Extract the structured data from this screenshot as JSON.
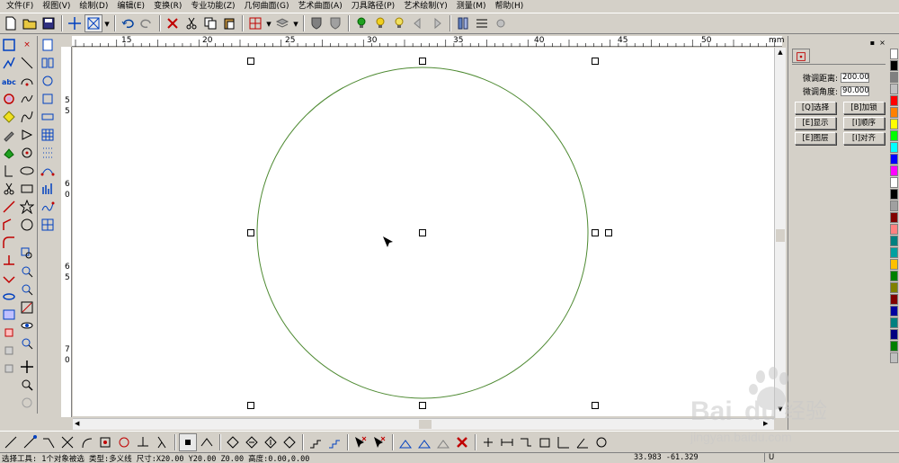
{
  "menu": [
    "文件(F)",
    "视图(V)",
    "绘制(D)",
    "编辑(E)",
    "变换(R)",
    "专业功能(Z)",
    "几何曲面(G)",
    "艺术曲面(A)",
    "刀具路径(P)",
    "艺术绘制(Y)",
    "测量(M)",
    "帮助(H)"
  ],
  "ruler": {
    "top_labels": [
      "15",
      "20",
      "25",
      "30",
      "35",
      "40",
      "45",
      "50"
    ],
    "unit": "mm",
    "left_labels": [
      "5",
      "5",
      "6",
      "0",
      "6",
      "5",
      "7",
      "0"
    ]
  },
  "panel": {
    "distance_label": "微调距离:",
    "distance_value": "200.00",
    "angle_label": "微调角度:",
    "angle_value": "90.000",
    "buttons": [
      "[Q]选择",
      "[B]加锁",
      "[E]显示",
      "[I]顺序",
      "[E]图层",
      "[I]对齐"
    ]
  },
  "status": {
    "text": "选择工具: 1个对象被选 类型:多义线 尺寸:X20.00 Y20.00 Z0.00 高度:0.00,0.00",
    "coords": "33.983  -61.329",
    "unit_indicator": "U"
  },
  "watermark": {
    "brand": "Baidu",
    "brand_cn": "经验",
    "url": "jingyan.baidu.com"
  },
  "colors": {
    "circle": "#4e8a32",
    "palette": [
      "#ffffff",
      "#000000",
      "#808080",
      "#c0c0c0",
      "#ff0000",
      "#ff8000",
      "#ffff00",
      "#00ff00",
      "#00ffff",
      "#0000ff",
      "#ff00ff",
      "#ffffff",
      "#000000",
      "#a0a0a0",
      "#800000",
      "#ff8080",
      "#008080",
      "#00a0a0",
      "#ffc000",
      "#008000",
      "#808000",
      "#800000",
      "#0000a0",
      "#008080",
      "#000080",
      "#008000",
      "#c0c0c0"
    ]
  }
}
